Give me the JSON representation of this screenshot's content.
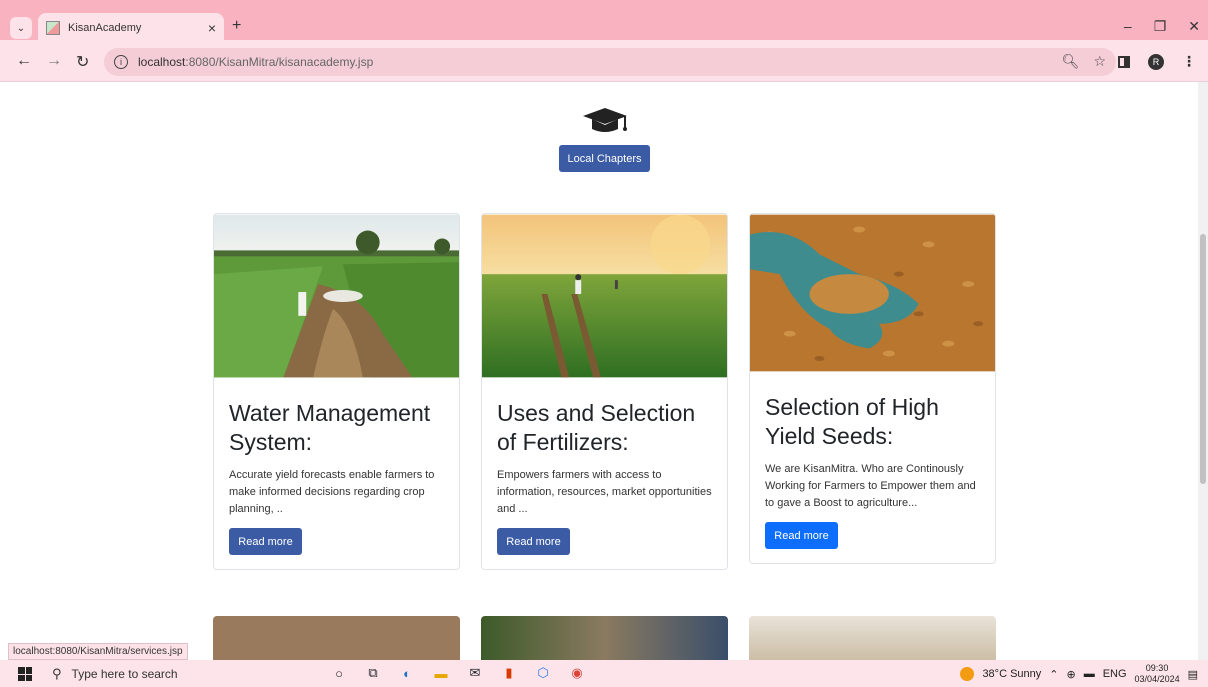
{
  "browser": {
    "tab_title": "KisanAcademy",
    "tab_close": "×",
    "new_tab": "+",
    "url_host": "localhost",
    "url_path": ":8080/KisanMitra/kisanacademy.jsp",
    "profile_initial": "R",
    "status_link": "localhost:8080/KisanMitra/services.jsp"
  },
  "hero": {
    "icon": "graduation-cap-icon",
    "button_label": "Local Chapters",
    "button_color": "#3b5ba5"
  },
  "cards": [
    {
      "title": "Water Management System:",
      "text": "Accurate yield forecasts enable farmers to make informed decisions regarding crop planning, ..",
      "button": "Read more",
      "button_color": "#3b5ba5"
    },
    {
      "title": "Uses and Selection of Fertilizers:",
      "text": "Empowers farmers with access to information, resources, market opportunities and ...",
      "button": "Read more",
      "button_color": "#3b5ba5"
    },
    {
      "title": "Selection of High Yield Seeds:",
      "text": "We are KisanMitra. Who are Continously Working for Farmers to Empower them and to gave a Boost to agriculture...",
      "button": "Read more",
      "button_color": "#0d6efd"
    }
  ],
  "taskbar": {
    "search_placeholder": "Type here to search",
    "weather": "38°C  Sunny",
    "language": "ENG",
    "time": "09:30",
    "date": "03/04/2024"
  }
}
